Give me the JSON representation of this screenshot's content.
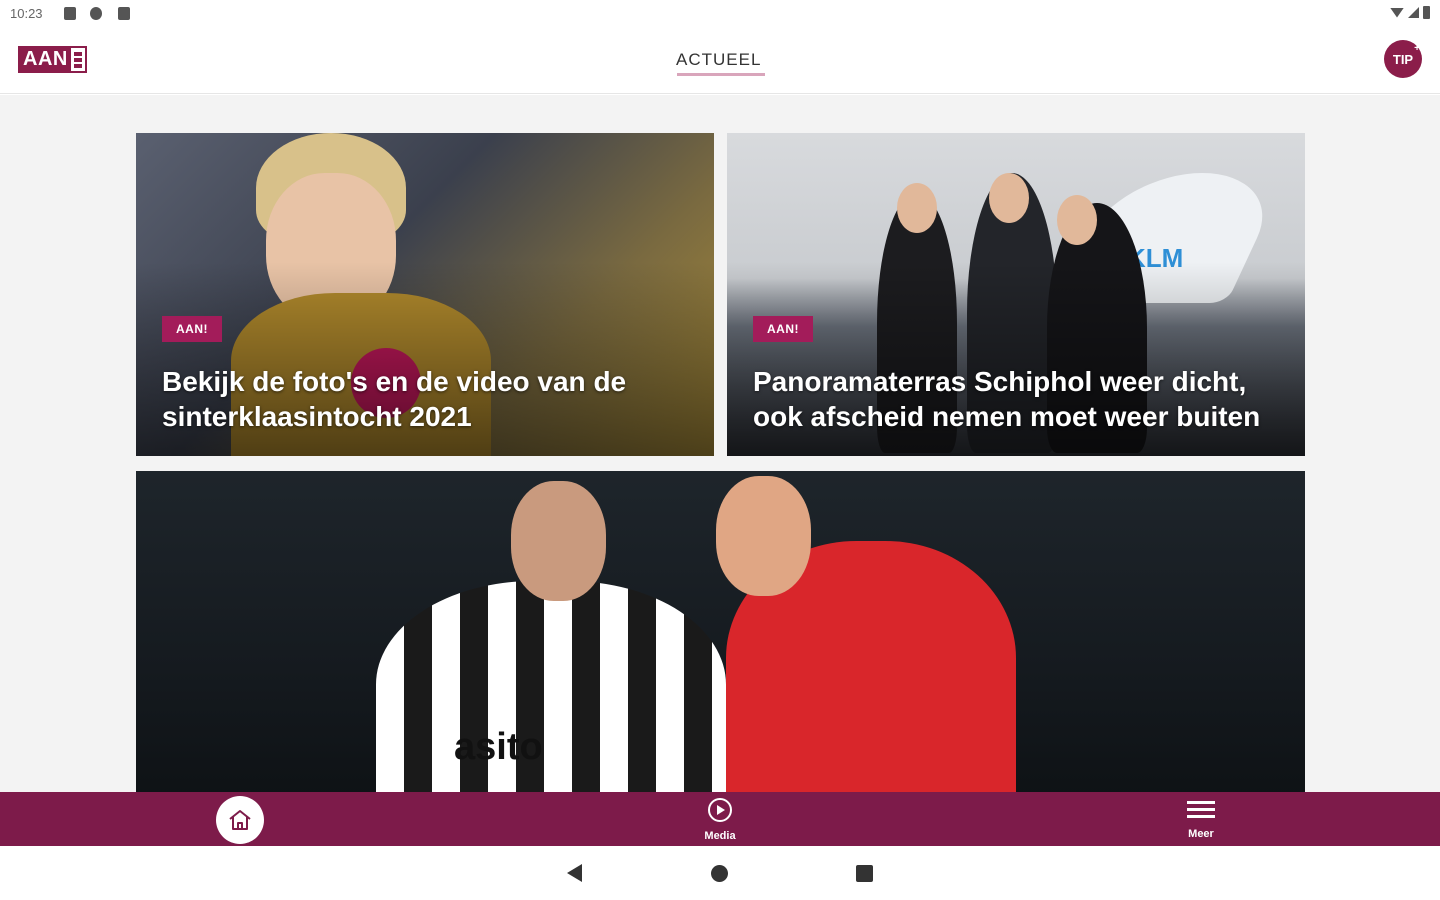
{
  "status_bar": {
    "time": "10:23"
  },
  "header": {
    "logo_text": "AAN",
    "active_tab": "ACTUEEL",
    "tip_label": "TIP",
    "tip_plus": "+"
  },
  "articles": [
    {
      "badge": "AAN!",
      "headline": "Bekijk de foto's en de video van de sinterklaasintocht 2021"
    },
    {
      "badge": "AAN!",
      "headline": "Panoramaterras Schiphol weer dicht, ook afscheid nemen moet weer buiten"
    }
  ],
  "photo_text": {
    "plane_logo": "KLM",
    "shirt_sponsor": "asito"
  },
  "bottom_nav": {
    "items": [
      {
        "label": "",
        "icon": "home-icon"
      },
      {
        "label": "Media",
        "icon": "play-icon"
      },
      {
        "label": "Meer",
        "icon": "menu-icon"
      }
    ]
  },
  "colors": {
    "brand": "#7d1b4a",
    "badge": "#a31c5a"
  }
}
